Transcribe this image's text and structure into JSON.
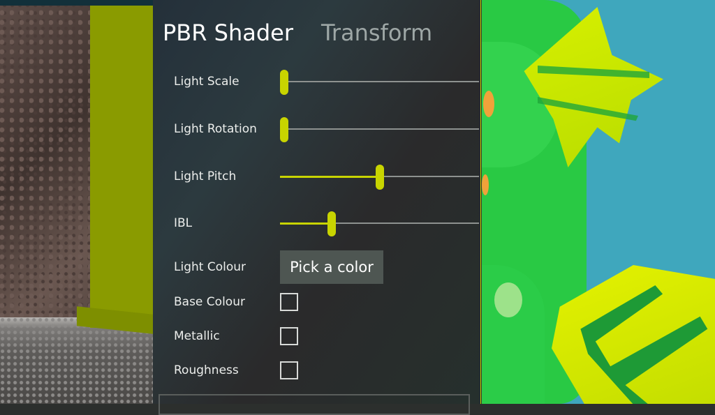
{
  "tabs": [
    {
      "label": "PBR Shader",
      "active": true
    },
    {
      "label": "Transform",
      "active": false
    }
  ],
  "sliders": [
    {
      "label": "Light Scale",
      "value": 0.02
    },
    {
      "label": "Light Rotation",
      "value": 0.02
    },
    {
      "label": "Light Pitch",
      "value": 0.5
    },
    {
      "label": "IBL",
      "value": 0.26
    }
  ],
  "light_colour": {
    "label": "Light Colour",
    "button_label": "Pick a color"
  },
  "checkboxes": [
    {
      "label": "Base Colour",
      "checked": false
    },
    {
      "label": "Metallic",
      "checked": false
    },
    {
      "label": "Roughness",
      "checked": false
    }
  ],
  "colors": {
    "accent": "#c8d400",
    "panel_bg": "#2a3035",
    "button_bg": "#4e5652"
  }
}
